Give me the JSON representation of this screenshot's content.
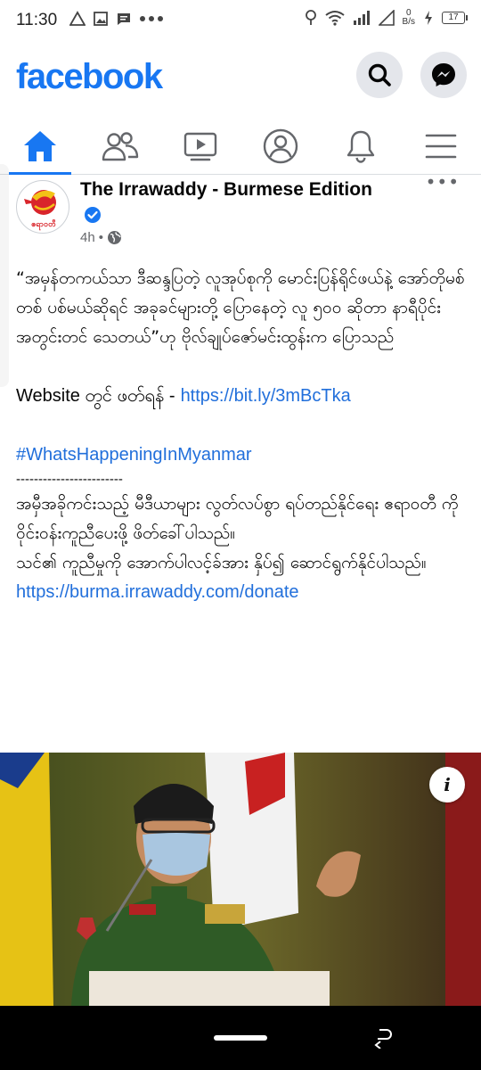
{
  "status_bar": {
    "time": "11:30",
    "net_speed_value": "0",
    "net_speed_unit": "B/s",
    "battery_level": "17"
  },
  "app": {
    "logo_text": "facebook",
    "brand_color": "#1877f2"
  },
  "nav_tabs": [
    {
      "icon": "home-icon",
      "active": true
    },
    {
      "icon": "friends-icon",
      "active": false
    },
    {
      "icon": "watch-icon",
      "active": false
    },
    {
      "icon": "profile-icon",
      "active": false
    },
    {
      "icon": "notifications-icon",
      "active": false
    },
    {
      "icon": "menu-icon",
      "active": false
    }
  ],
  "post": {
    "page_name": "The Irrawaddy - Burmese Edition",
    "avatar_text": "ဧရာဝတီ",
    "timestamp": "4h",
    "meta_separator": "•",
    "privacy": "globe-icon",
    "more": "•••",
    "quote_text": "“အမှန်တကယ်သာ ဒီဆန္ဒပြတဲ့ လူအုပ်စုကို မောင်းပြန်ရိုင်ဖယ်နဲ့ အော်တိုမစ်တစ် ပစ်မယ်ဆိုရင် အခုခင်များတို့ ပြောနေတဲ့ လူ ၅၀၀ ဆိုတာ နာရီပိုင်းအတွင်းတင် သေတယ်”ဟု ဗိုလ်ချုပ်ဇော်မင်းထွန်းက ပြောသည်",
    "website_label": "Website တွင် ဖတ်ရန် -",
    "website_url": "https://bit.ly/3mBcTka",
    "hashtag": "#WhatsHappeningInMyanmar",
    "divider": "------------------------",
    "donate_text_1": "အမှီအခိုကင်းသည့် မီဒီယာများ လွတ်လပ်စွာ ရပ်တည်နိုင်ရေး ဧရာဝတီ ကို ဝိုင်းဝန်းကူညီပေးဖို့ ဖိတ်ခေါ်ပါသည်။",
    "donate_text_2": "သင်၏ ကူညီမှုကို အောက်ပါလင့်ခ်အား နှိပ်၍ ဆောင်ရွက်နိုင်ပါသည်။",
    "donate_url": "https://burma.irrawaddy.com/donate",
    "photo_info": "i"
  }
}
